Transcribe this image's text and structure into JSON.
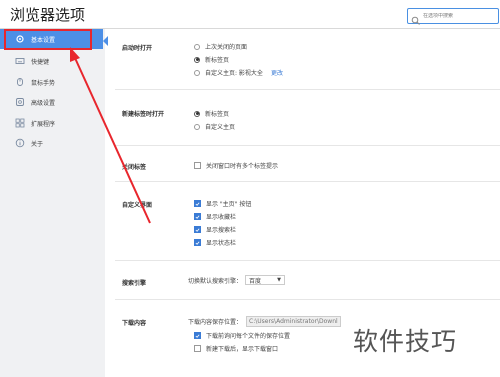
{
  "window": {
    "title": "浏览器选项"
  },
  "search": {
    "placeholder": "在选项中搜索"
  },
  "sidebar": {
    "items": [
      {
        "label": "基本设置",
        "icon": "gear-icon",
        "active": true
      },
      {
        "label": "快捷键",
        "icon": "keyboard-icon"
      },
      {
        "label": "鼠标手势",
        "icon": "mouse-gesture-icon"
      },
      {
        "label": "高级设置",
        "icon": "advanced-settings-icon"
      },
      {
        "label": "扩展程序",
        "icon": "extensions-icon"
      },
      {
        "label": "关于",
        "icon": "info-icon"
      }
    ]
  },
  "startup": {
    "label": "启动时打开",
    "options": [
      "上次关闭的页面",
      "新标签页",
      "自定义主页: 影视大全"
    ],
    "selected": 1,
    "change_link": "更改"
  },
  "new_tab": {
    "label": "新建标签时打开",
    "options": [
      "新标签页",
      "自定义主页"
    ],
    "selected": 0
  },
  "close_tab": {
    "label": "关闭标签",
    "option": "关闭窗口时有多个标签提示",
    "checked": false
  },
  "custom_ui": {
    "label": "自定义界面",
    "options": [
      "显示 \"主页\" 按钮",
      "显示收藏栏",
      "显示搜索栏",
      "显示状态栏"
    ],
    "checked": [
      true,
      true,
      true,
      true
    ]
  },
  "search_engine": {
    "label": "搜索引擎",
    "prompt": "切换默认搜索引擎：",
    "value": "百度"
  },
  "download": {
    "label": "下载内容",
    "path_label": "下载内容保存位置：",
    "path": "C:\\Users\\Administrator\\Downl",
    "options": [
      "下载前询问每个文件的保存位置",
      "新建下载后，显示下载窗口"
    ],
    "checked": [
      true,
      false
    ]
  },
  "watermark": {
    "text": "软件技巧"
  },
  "colors": {
    "accent": "#4d8fe6",
    "annotation": "#e8262d"
  }
}
